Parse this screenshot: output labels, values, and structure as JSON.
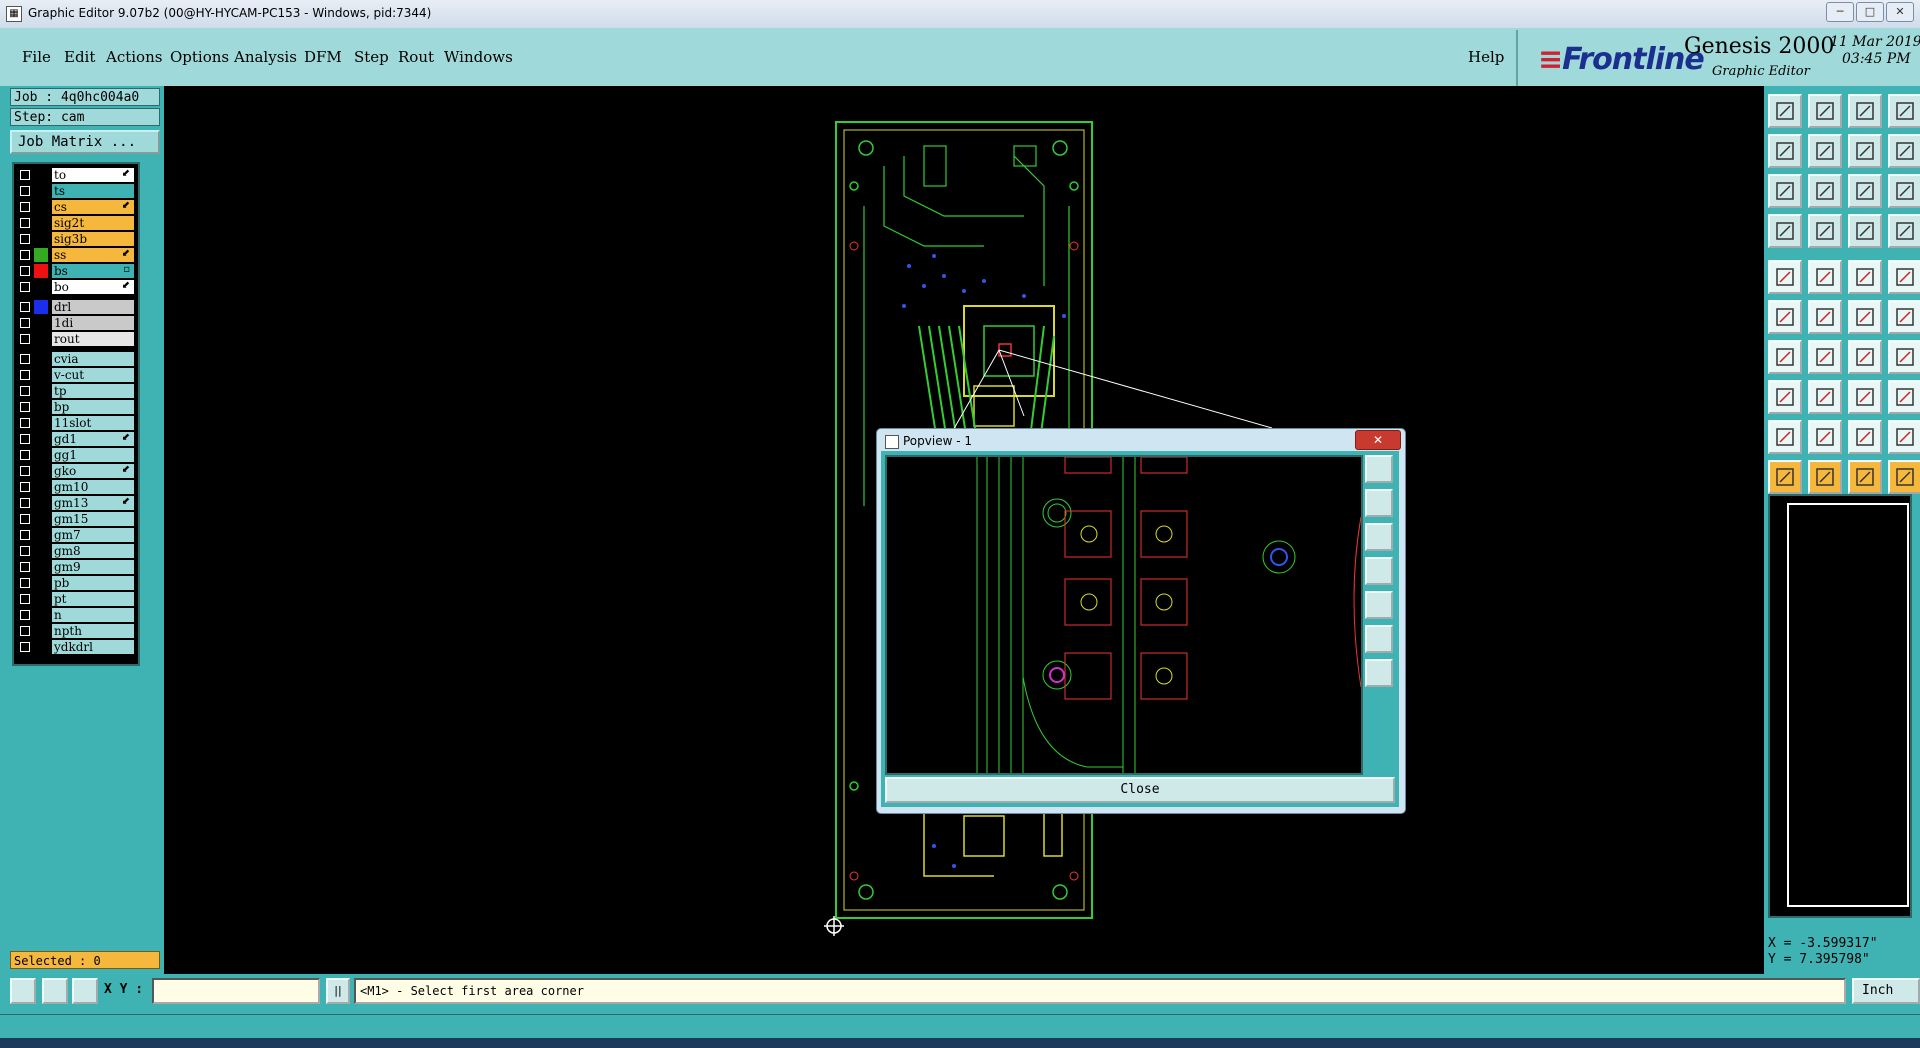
{
  "window": {
    "title": "Graphic Editor 9.07b2 (00@HY-HYCAM-PC153 - Windows, pid:7344)",
    "minimize": "─",
    "maximize": "□",
    "close": "✕"
  },
  "menu": [
    {
      "label": "File"
    },
    {
      "label": "Edit"
    },
    {
      "label": "Actions"
    },
    {
      "label": "Options"
    },
    {
      "label": "Analysis"
    },
    {
      "label": "DFM"
    },
    {
      "label": "Step"
    },
    {
      "label": "Rout"
    },
    {
      "label": "Windows"
    },
    {
      "label": "Help"
    }
  ],
  "brand": {
    "logo": "Frontline",
    "product": "Genesis 2000",
    "subtitle": "Graphic Editor",
    "date": "11 Mar 2019",
    "time": "03:45 PM"
  },
  "job": {
    "job_label": "Job : 4q0hc004a0",
    "step_label": "Step: cam",
    "matrix_button": "Job Matrix ..."
  },
  "layers": [
    {
      "name": "to",
      "bg": "#ffffff",
      "swatch": "#000000",
      "mark": "⬋"
    },
    {
      "name": "ts",
      "bg": "#3fb3b3",
      "swatch": "#000000",
      "mark": ""
    },
    {
      "name": "cs",
      "bg": "#f5b83c",
      "swatch": "#000000",
      "mark": "⬋"
    },
    {
      "name": "sig2t",
      "bg": "#f5b83c",
      "swatch": "#000000",
      "mark": ""
    },
    {
      "name": "sig3b",
      "bg": "#f5b83c",
      "swatch": "#000000",
      "mark": ""
    },
    {
      "name": "ss",
      "bg": "#f5b83c",
      "swatch": "#33aa22",
      "mark": "⬋"
    },
    {
      "name": "bs",
      "bg": "#3fb3b3",
      "swatch": "#ee1111",
      "mark": "▫"
    },
    {
      "name": "bo",
      "bg": "#ffffff",
      "swatch": "#000000",
      "mark": "⬋"
    },
    {
      "name": "drl",
      "bg": "#c9c9c9",
      "swatch": "#1a2fee",
      "mark": ""
    },
    {
      "name": "1di",
      "bg": "#c9c9c9",
      "swatch": "#000000",
      "mark": ""
    },
    {
      "name": "rout",
      "bg": "#e6e6e6",
      "swatch": "#000000",
      "mark": ""
    },
    {
      "name": "cvia",
      "bg": "#9fd9d9",
      "swatch": "#000000",
      "mark": ""
    },
    {
      "name": "v-cut",
      "bg": "#9fd9d9",
      "swatch": "#000000",
      "mark": ""
    },
    {
      "name": "tp",
      "bg": "#9fd9d9",
      "swatch": "#000000",
      "mark": ""
    },
    {
      "name": "bp",
      "bg": "#9fd9d9",
      "swatch": "#000000",
      "mark": ""
    },
    {
      "name": "11slot",
      "bg": "#9fd9d9",
      "swatch": "#000000",
      "mark": ""
    },
    {
      "name": "gd1",
      "bg": "#9fd9d9",
      "swatch": "#000000",
      "mark": "⬋"
    },
    {
      "name": "gg1",
      "bg": "#9fd9d9",
      "swatch": "#000000",
      "mark": ""
    },
    {
      "name": "gko",
      "bg": "#9fd9d9",
      "swatch": "#000000",
      "mark": "⬋"
    },
    {
      "name": "gm10",
      "bg": "#9fd9d9",
      "swatch": "#000000",
      "mark": ""
    },
    {
      "name": "gm13",
      "bg": "#9fd9d9",
      "swatch": "#000000",
      "mark": "⬋"
    },
    {
      "name": "gm15",
      "bg": "#9fd9d9",
      "swatch": "#000000",
      "mark": ""
    },
    {
      "name": "gm7",
      "bg": "#9fd9d9",
      "swatch": "#000000",
      "mark": ""
    },
    {
      "name": "gm8",
      "bg": "#9fd9d9",
      "swatch": "#000000",
      "mark": ""
    },
    {
      "name": "gm9",
      "bg": "#9fd9d9",
      "swatch": "#000000",
      "mark": ""
    },
    {
      "name": "pb",
      "bg": "#9fd9d9",
      "swatch": "#000000",
      "mark": ""
    },
    {
      "name": "pt",
      "bg": "#9fd9d9",
      "swatch": "#000000",
      "mark": ""
    },
    {
      "name": "n",
      "bg": "#9fd9d9",
      "swatch": "#000000",
      "mark": ""
    },
    {
      "name": "npth",
      "bg": "#9fd9d9",
      "swatch": "#000000",
      "mark": ""
    },
    {
      "name": "ydkdrl",
      "bg": "#9fd9d9",
      "swatch": "#000000",
      "mark": ""
    }
  ],
  "selected": "Selected : 0",
  "popview": {
    "title": "Popview - 1",
    "close_button": "Close",
    "close_x": "✕"
  },
  "coords": {
    "x": "X = -3.599317\"",
    "y": "Y = 7.395798\""
  },
  "statusbar": {
    "xy_label": "X Y :",
    "xy_value": "",
    "separator": "||",
    "prompt": "<M1> - Select first area corner",
    "unit": "Inch"
  },
  "colors": {
    "panel": "#3fb3b3",
    "menubar": "#9fd9d9",
    "highlight": "#f5b83c",
    "pcb_green": "#33cc33",
    "pcb_yellow": "#d9d92a"
  }
}
